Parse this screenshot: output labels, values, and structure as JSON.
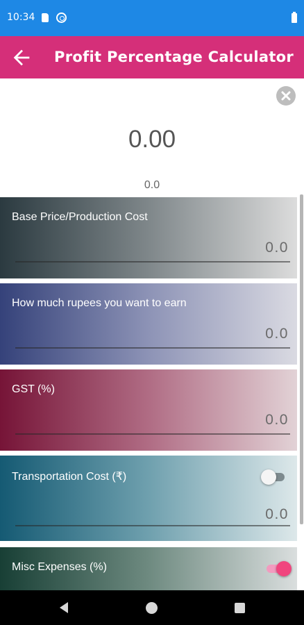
{
  "status_bar": {
    "time": "10:34",
    "icons": [
      "sim-icon",
      "sync-icon",
      "battery-icon"
    ]
  },
  "app_bar": {
    "title": "Profit Percentage Calculator",
    "back_icon": "arrow-left-icon"
  },
  "result": {
    "value": "0.00",
    "secondary": "0.0",
    "clear_icon": "close-circle-icon"
  },
  "fields": {
    "base_price": {
      "label": "Base Price/Production Cost",
      "placeholder": "0.0"
    },
    "earn": {
      "label": "How much rupees you want to earn",
      "placeholder": "0.0"
    },
    "gst": {
      "label": "GST (%)",
      "placeholder": "0.0"
    },
    "transport": {
      "label": "Transportation Cost (₹)",
      "placeholder": "0.0",
      "toggle_on": false
    },
    "misc": {
      "label": "Misc Expenses (%)",
      "toggle_on": true
    }
  },
  "colors": {
    "status_bar": "#1e88e5",
    "app_bar": "#d52f79",
    "toggle_accent": "#f0457e"
  },
  "nav_bar": {
    "icons": [
      "back-triangle-icon",
      "home-circle-icon",
      "recents-square-icon"
    ]
  }
}
